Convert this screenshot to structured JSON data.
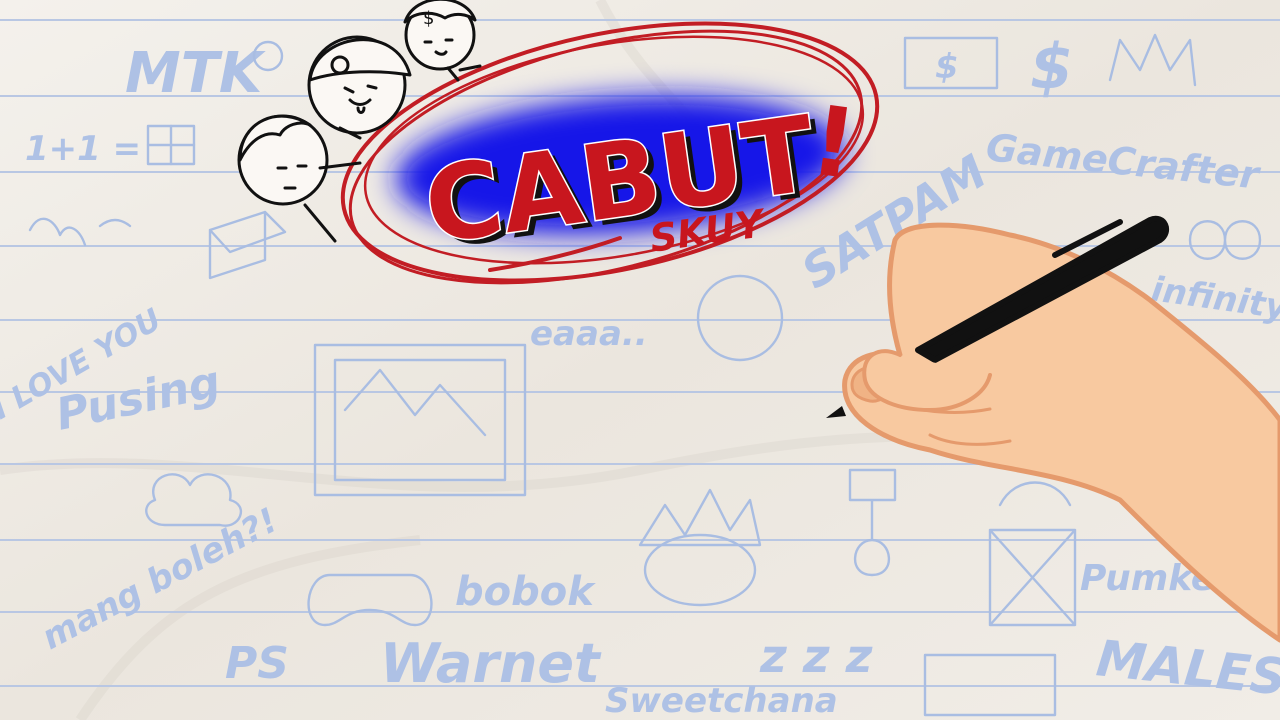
{
  "title": {
    "main": "CABUT",
    "exclaim": "!",
    "sub": "SKUY"
  },
  "doodles": {
    "mtk": "MTK",
    "math": "1+1 =",
    "gamecrafter": "GameCrafter",
    "satpam": "SATPAM",
    "infinity": "infinity",
    "love": "I LOVE YOU",
    "pusing": "Pusing",
    "eaaa": "eaaa..",
    "mangboleh": "mang boleh?!",
    "ps": "PS",
    "warnet": "Warnet",
    "bobok": "bobok",
    "zzz": "z z z",
    "pumkeen": "Pumkeen",
    "males": "MALES!",
    "sweet": "Sweetchana"
  },
  "colors": {
    "paper": "#efebe4",
    "ruled_line": "#b9c7e3",
    "doodle": "#a9bde2",
    "title_red": "#c8161e",
    "title_blue": "#1616e8",
    "circle_red": "#c21d24",
    "skin": "#f8c9a0",
    "skin_outline": "#e59a6c",
    "pen": "#111111"
  },
  "icons": [
    "cartoon-face-icon",
    "hand-with-pen-icon",
    "dollar-bill-icon",
    "crown-icon",
    "gamepad-icon",
    "coin-icon",
    "dollar-sign-icon"
  ]
}
